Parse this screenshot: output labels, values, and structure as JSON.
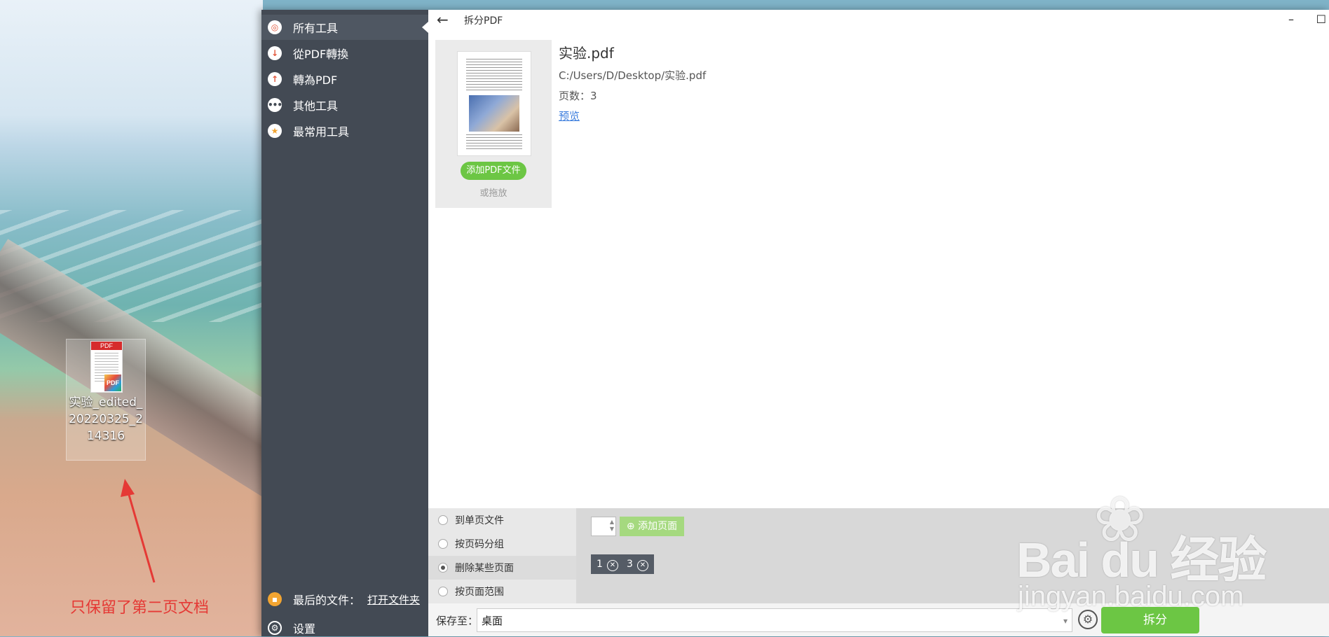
{
  "desktop": {
    "file_label": "实验_edited_20220325_214316",
    "file_doc_header": "PDF",
    "file_badge": "PDF",
    "annotation": "只保留了第二页文档"
  },
  "sidebar": {
    "items": [
      {
        "label": "所有工具",
        "icon": "target-icon"
      },
      {
        "label": "從PDF轉換",
        "icon": "arrow-down-icon"
      },
      {
        "label": "轉為PDF",
        "icon": "arrow-up-icon"
      },
      {
        "label": "其他工具",
        "icon": "more-dots-icon"
      },
      {
        "label": "最常用工具",
        "icon": "star-icon"
      }
    ],
    "last_files_label": "最后的文件：",
    "open_folder_link": "打开文件夹",
    "settings_label": "设置"
  },
  "titlebar": {
    "back_glyph": "←",
    "title": "拆分PDF",
    "minimize_glyph": "–",
    "maximize_glyph": "☐"
  },
  "file": {
    "name": "实验.pdf",
    "path": "C:/Users/D/Desktop/实验.pdf",
    "pages": "页数：3",
    "preview_link": "预览",
    "add_button": "添加PDF文件",
    "drag_hint": "或拖放"
  },
  "options": [
    {
      "label": "到单页文件",
      "selected": false
    },
    {
      "label": "按页码分组",
      "selected": false
    },
    {
      "label": "删除某些页面",
      "selected": true
    },
    {
      "label": "按页面范围",
      "selected": false
    }
  ],
  "operations": {
    "add_page_button": "添加页面",
    "chips": [
      "1",
      "3"
    ]
  },
  "bottombar": {
    "save_label": "保存至：",
    "save_location": "桌面",
    "split_button": "拆分"
  },
  "watermark": {
    "brand": "Bai du 经验",
    "url": "jingyan.baidu.com"
  },
  "colors": {
    "sidebar_bg": "#434a54",
    "accent_green": "#6cc644",
    "link_blue": "#3b7ddd",
    "annotation_red": "#e53935"
  }
}
